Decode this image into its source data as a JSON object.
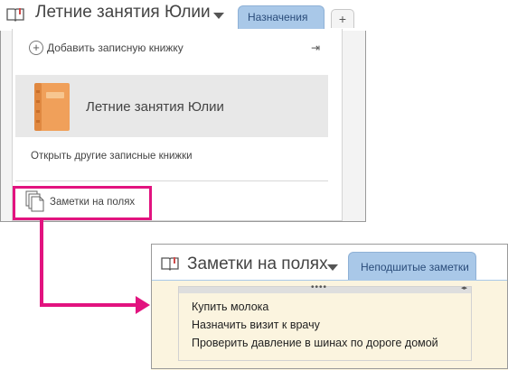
{
  "top_panel": {
    "notebook_title": "Летние занятия Юлии",
    "active_tab": "Назначения",
    "new_tab_label": "+",
    "add_notebook_label": "Добавить записную книжку",
    "pin_glyph": "⇥",
    "notebook_item_label": "Летние занятия Юлии",
    "open_other_label": "Открыть другие записные книжки",
    "quick_notes_label": "Заметки на полях"
  },
  "bottom_panel": {
    "notebook_title": "Заметки на полях",
    "active_tab": "Неподшитые заметки",
    "note_lines": [
      "Купить молока",
      "Назначить визит к врачу",
      "Проверить давление в шинах по дороге домой"
    ],
    "handle_dots": "••••",
    "handle_arrows": "◂▸"
  },
  "colors": {
    "highlight": "#e2137f",
    "tab_blue": "#a9c8e8",
    "notebook_orange": "#f0a05a",
    "note_background": "#fbf4df"
  },
  "icons": {
    "notebook": "notebook-icon",
    "add": "plus-circle-icon",
    "pin": "pin-icon",
    "quick_notes": "pages-icon",
    "dropdown": "chevron-down-icon"
  }
}
